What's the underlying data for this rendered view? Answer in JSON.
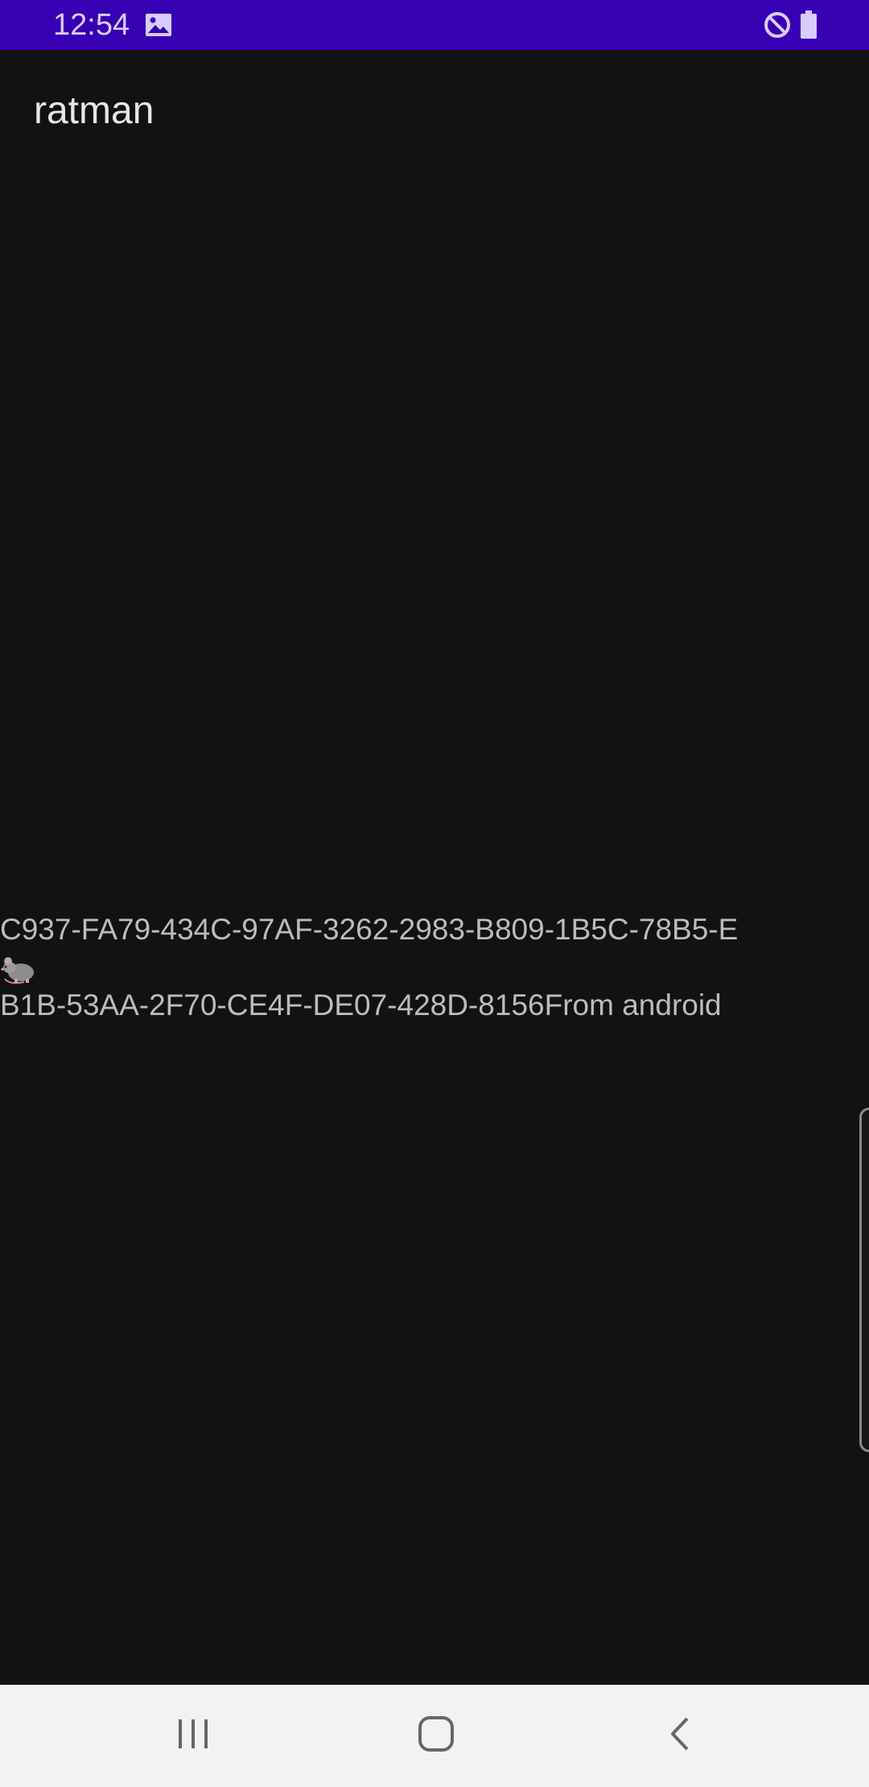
{
  "status_bar": {
    "time": "12:54",
    "background_color": "#3700b3",
    "icons": [
      "image-icon",
      "do-not-disturb-icon",
      "battery-icon"
    ]
  },
  "app": {
    "title": "ratman"
  },
  "message": {
    "line1": "C937-FA79-434C-97AF-3262-2983-B809-1B5C-78B5-E",
    "line2": "B1B-53AA-2F70-CE4F-DE07-428D-8156From android",
    "emoji": "🐀"
  },
  "nav_bar": {
    "buttons": [
      "recents-icon",
      "home-icon",
      "back-icon"
    ]
  },
  "colors": {
    "background": "#121212",
    "text": "#bcbcbc",
    "title": "#e6e6e6"
  }
}
